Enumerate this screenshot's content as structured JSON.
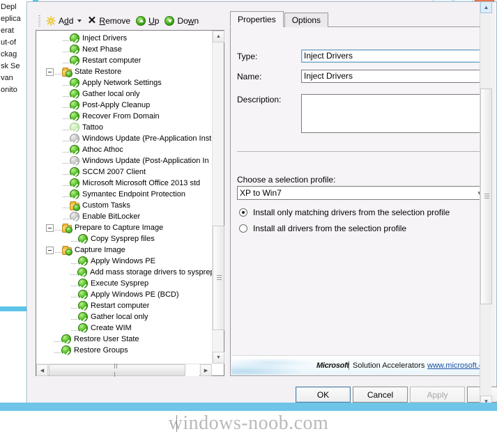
{
  "background_window": {
    "tree_items": [
      "Depl",
      "eplica",
      "erat",
      "ut-of",
      "ckag",
      "sk Se",
      "van",
      "onito"
    ]
  },
  "window_controls": {
    "minimize": "minimize-button",
    "maximize": "maximize-button",
    "close": "close-button",
    "scroll_up": "▲",
    "scroll_down": "▼"
  },
  "toolbar": {
    "add": "Add",
    "remove": "Remove",
    "up": "Up",
    "down": "Down"
  },
  "tree": {
    "items": [
      {
        "label": "Inject Drivers",
        "indent": 3,
        "icon": "check-green",
        "expander": "none"
      },
      {
        "label": "Next Phase",
        "indent": 3,
        "icon": "check-green",
        "expander": "none"
      },
      {
        "label": "Restart computer",
        "indent": 3,
        "icon": "check-green",
        "expander": "none"
      },
      {
        "label": "State Restore",
        "indent": 1,
        "icon": "folder",
        "expander": "expanded"
      },
      {
        "label": "Apply Network Settings",
        "indent": 3,
        "icon": "check-green",
        "expander": "none"
      },
      {
        "label": "Gather local only",
        "indent": 3,
        "icon": "check-green",
        "expander": "none"
      },
      {
        "label": "Post-Apply Cleanup",
        "indent": 3,
        "icon": "check-green",
        "expander": "none"
      },
      {
        "label": "Recover From Domain",
        "indent": 3,
        "icon": "check-green",
        "expander": "none"
      },
      {
        "label": "Tattoo",
        "indent": 3,
        "icon": "check-pale",
        "expander": "none"
      },
      {
        "label": "Windows Update (Pre-Application Inst",
        "indent": 3,
        "icon": "check-grey",
        "expander": "none"
      },
      {
        "label": "Athoc Athoc",
        "indent": 3,
        "icon": "check-green",
        "expander": "none"
      },
      {
        "label": "Windows Update (Post-Application In",
        "indent": 3,
        "icon": "check-grey",
        "expander": "none"
      },
      {
        "label": "SCCM 2007 Client",
        "indent": 3,
        "icon": "check-green",
        "expander": "none"
      },
      {
        "label": "Microsoft Microsoft Office 2013 std",
        "indent": 3,
        "icon": "check-green",
        "expander": "none"
      },
      {
        "label": "Symantec Endpoint Protection",
        "indent": 3,
        "icon": "check-green",
        "expander": "none"
      },
      {
        "label": "Custom Tasks",
        "indent": 3,
        "icon": "folder",
        "expander": "none"
      },
      {
        "label": "Enable BitLocker",
        "indent": 3,
        "icon": "check-grey",
        "expander": "none"
      },
      {
        "label": "Prepare to Capture Image",
        "indent": 1,
        "icon": "folder",
        "expander": "expanded"
      },
      {
        "label": "Copy Sysprep files",
        "indent": 4,
        "icon": "check-green",
        "expander": "none"
      },
      {
        "label": "Capture Image",
        "indent": 1,
        "icon": "folder",
        "expander": "expanded"
      },
      {
        "label": "Apply Windows PE",
        "indent": 4,
        "icon": "check-green",
        "expander": "none"
      },
      {
        "label": "Add mass storage drivers to sysprep",
        "indent": 4,
        "icon": "check-green",
        "expander": "none"
      },
      {
        "label": "Execute Sysprep",
        "indent": 4,
        "icon": "check-green",
        "expander": "none"
      },
      {
        "label": "Apply Windows PE (BCD)",
        "indent": 4,
        "icon": "check-green",
        "expander": "none"
      },
      {
        "label": "Restart computer",
        "indent": 4,
        "icon": "check-green",
        "expander": "none"
      },
      {
        "label": "Gather local only",
        "indent": 4,
        "icon": "check-green",
        "expander": "none"
      },
      {
        "label": "Create WIM",
        "indent": 4,
        "icon": "check-green",
        "expander": "none"
      },
      {
        "label": "Restore User State",
        "indent": 2,
        "icon": "check-green",
        "expander": "none"
      },
      {
        "label": "Restore Groups",
        "indent": 2,
        "icon": "check-green",
        "expander": "none"
      }
    ]
  },
  "tabs": [
    {
      "label": "Properties",
      "active": true
    },
    {
      "label": "Options",
      "active": false
    }
  ],
  "properties": {
    "type_label": "Type:",
    "type_value": "Inject Drivers",
    "name_label": "Name:",
    "name_value": "Inject Drivers",
    "description_label": "Description:",
    "description_value": "",
    "selection_profile_label": "Choose a selection profile:",
    "selection_profile_value": "XP to Win7",
    "radio_matching": "Install only matching drivers from the selection profile",
    "radio_all": "Install all drivers from the selection profile",
    "radio_selected": "matching"
  },
  "branding": {
    "microsoft": "Microsoft",
    "solution_accelerators": "Solution Accelerators",
    "link": "www.microsoft.com"
  },
  "footer": {
    "ok": "OK",
    "cancel": "Cancel",
    "apply": "Apply"
  },
  "watermark": {
    "text": "windows-noob.com"
  },
  "colors": {
    "accent_blue": "#5ec3e8",
    "dialog_bg": "#f4f1f4",
    "tab_page_bg": "#f7f4f7",
    "check_green": "#4cbb1e",
    "close_red": "#e8744f",
    "link_blue": "#1a4fa0"
  }
}
